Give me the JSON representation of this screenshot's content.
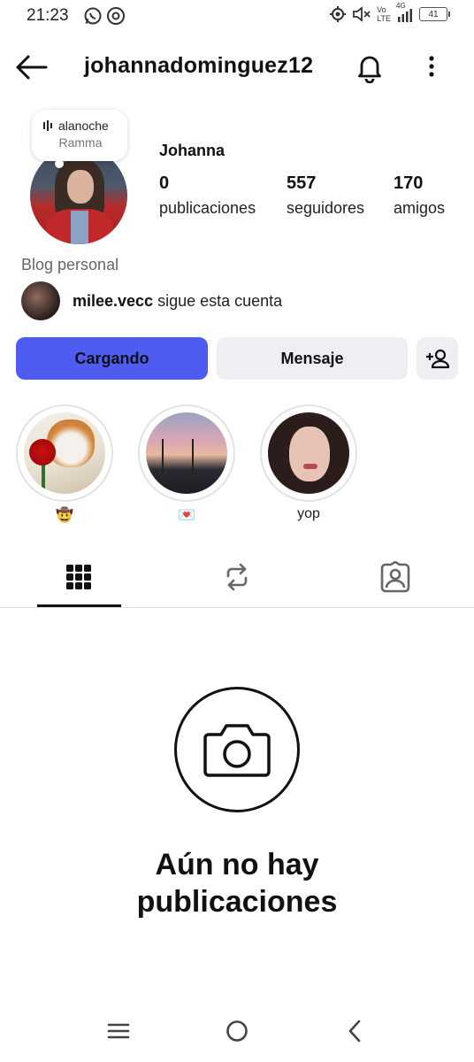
{
  "status_bar": {
    "time": "21:23",
    "network_label_top": "Vo",
    "network_label_bottom": "LTE",
    "signal_label": "4G",
    "battery": "41",
    "icons": [
      "whatsapp-icon",
      "threads-icon",
      "location-icon",
      "mute-icon",
      "signal-icon",
      "battery-icon"
    ]
  },
  "header": {
    "username": "johannadominguez12",
    "icons": [
      "back-arrow-icon",
      "bell-icon",
      "more-vertical-icon"
    ]
  },
  "profile": {
    "note": {
      "text": "alanoche",
      "artist": "Ramma"
    },
    "display_name": "Johanna",
    "stats": [
      {
        "value": "0",
        "label": "publicaciones"
      },
      {
        "value": "557",
        "label": "seguidores"
      },
      {
        "value": "170",
        "label": "amigos"
      }
    ],
    "bio": "Blog personal",
    "followed_by": {
      "username": "milee.vecc",
      "text": " sigue esta cuenta"
    }
  },
  "actions": {
    "primary_label": "Cargando",
    "secondary_label": "Mensaje",
    "add_friend_icon": "person-add-icon",
    "primary_color": "#4f5cf2"
  },
  "highlights": [
    {
      "label": "🤠"
    },
    {
      "label": "💌"
    },
    {
      "label": "yop"
    }
  ],
  "tabs": [
    {
      "icon": "grid-icon",
      "active": true
    },
    {
      "icon": "repost-icon",
      "active": false
    },
    {
      "icon": "tagged-icon",
      "active": false
    }
  ],
  "empty_state": {
    "title_line1": "Aún no hay",
    "title_line2": "publicaciones",
    "icon": "camera-icon"
  },
  "nav_bar": {
    "icons": [
      "menu-icon",
      "home-icon",
      "back-icon"
    ]
  }
}
